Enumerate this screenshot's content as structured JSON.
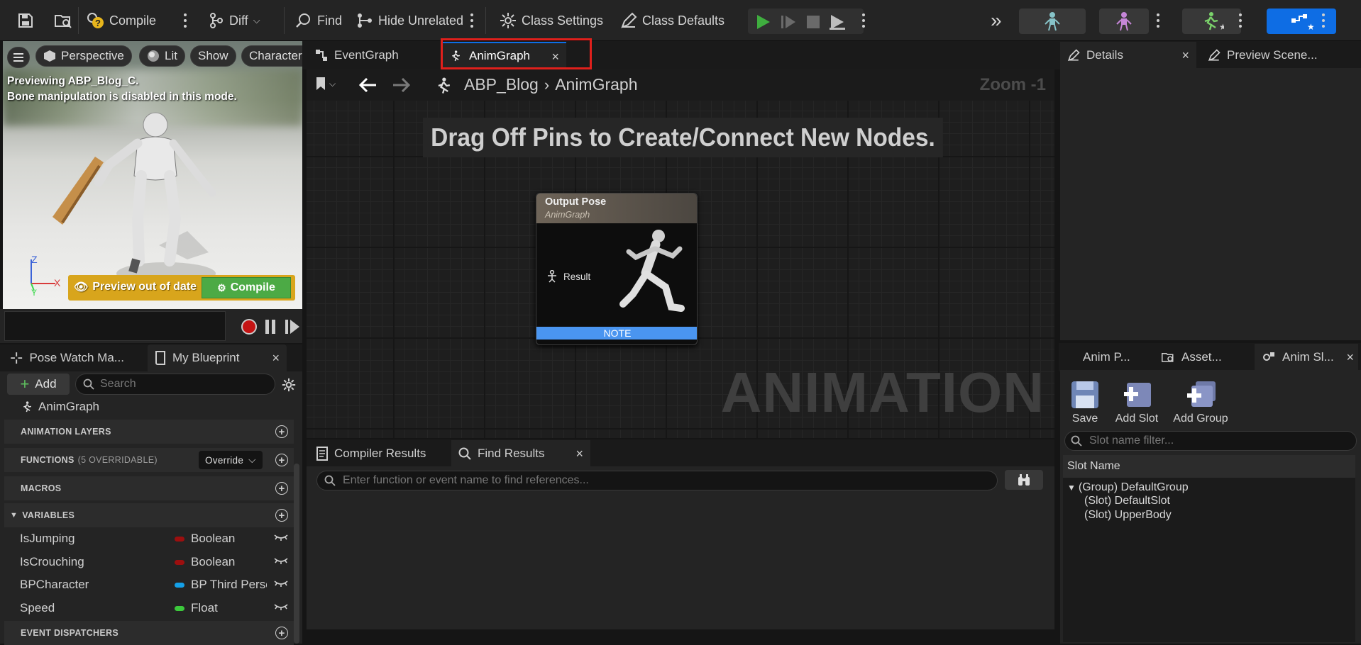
{
  "toolbar": {
    "compile_label": "Compile",
    "diff_label": "Diff",
    "find_label": "Find",
    "hide_unrelated_label": "Hide Unrelated",
    "class_settings_label": "Class Settings",
    "class_defaults_label": "Class Defaults"
  },
  "viewport": {
    "perspective_label": "Perspective",
    "lit_label": "Lit",
    "show_label": "Show",
    "character_label": "Character",
    "info_line1": "Previewing ABP_Blog_C.",
    "info_line2": "Bone manipulation is disabled in this mode.",
    "axis_z": "Z",
    "axis_x": "X",
    "axis_y": "Y",
    "preview_out_of_date": "Preview out of date",
    "compile_label": "Compile"
  },
  "graph_tabs": [
    {
      "label": "EventGraph"
    },
    {
      "label": "AnimGraph",
      "close": "×"
    }
  ],
  "graph": {
    "breadcrumb_root": "ABP_Blog",
    "breadcrumb_leaf": "AnimGraph",
    "zoom": "Zoom -1",
    "hint": "Drag Off Pins to Create/Connect New Nodes.",
    "watermark": "ANIMATION",
    "node": {
      "title": "Output Pose",
      "subtitle": "AnimGraph",
      "pin": "Result",
      "note": "NOTE"
    }
  },
  "bottom_tabs": [
    {
      "label": "Compiler Results"
    },
    {
      "label": "Find Results",
      "close": "×"
    }
  ],
  "find": {
    "placeholder": "Enter function or event name to find references..."
  },
  "left_tabs": [
    {
      "label": "Pose Watch Ma..."
    },
    {
      "label": "My Blueprint",
      "close": "×"
    }
  ],
  "my_blueprint": {
    "add_label": "Add",
    "search_placeholder": "Search",
    "anim_graph": "AnimGraph",
    "sections": {
      "animation_layers": "ANIMATION LAYERS",
      "functions": "FUNCTIONS",
      "functions_note": "(5 OVERRIDABLE)",
      "override_label": "Override",
      "macros": "MACROS",
      "variables": "VARIABLES",
      "event_dispatchers": "EVENT DISPATCHERS"
    },
    "variables": [
      {
        "name": "IsJumping",
        "type": "Boolean",
        "color": "#9c0f0f"
      },
      {
        "name": "IsCrouching",
        "type": "Boolean",
        "color": "#9c0f0f"
      },
      {
        "name": "BPCharacter",
        "type": "BP Third Person Character",
        "color": "#14a0e8"
      },
      {
        "name": "Speed",
        "type": "Float",
        "color": "#3cc93c"
      }
    ]
  },
  "right_tabs": [
    {
      "label": "Details",
      "close": "×"
    },
    {
      "label": "Preview Scene..."
    }
  ],
  "right_lower_tabs": [
    {
      "label": "Anim P..."
    },
    {
      "label": "Asset..."
    },
    {
      "label": "Anim Sl...",
      "close": "×"
    }
  ],
  "slots": {
    "save_label": "Save",
    "add_slot_label": "Add Slot",
    "add_group_label": "Add Group",
    "filter_placeholder": "Slot name filter...",
    "column_header": "Slot Name",
    "group": "(Group) DefaultGroup",
    "items": [
      "(Slot) DefaultSlot",
      "(Slot) UpperBody"
    ]
  },
  "colors": {
    "accent_blue": "#0e6de4",
    "play_green": "#3fae3f",
    "preview_warning": "#d8a51c",
    "compile_green": "#4caa45",
    "highlight_red": "#e0201c"
  }
}
